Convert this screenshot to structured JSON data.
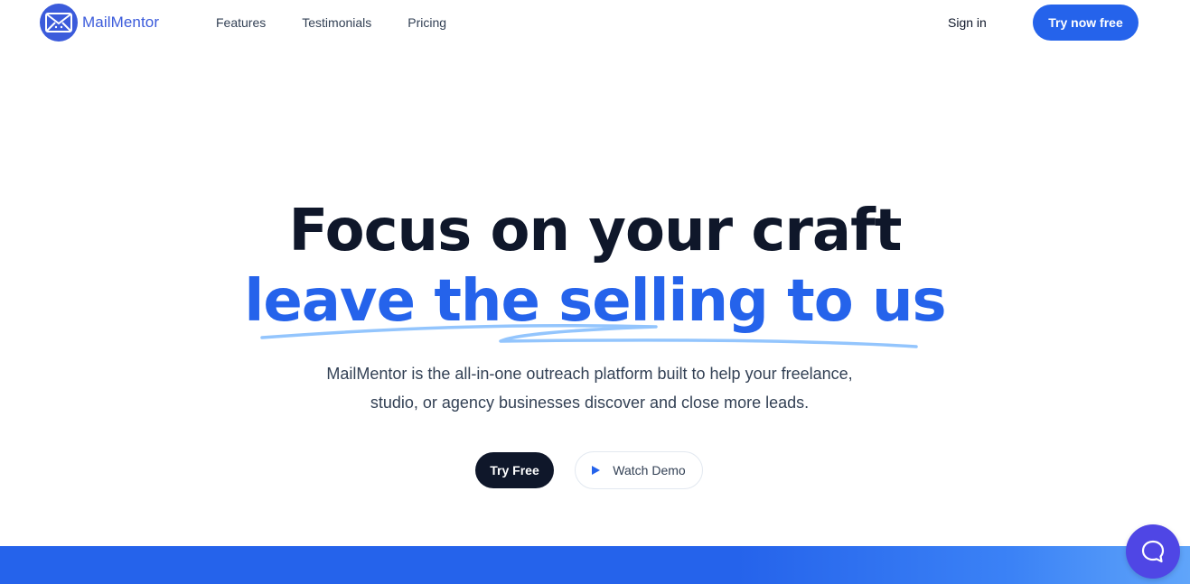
{
  "header": {
    "brand": "MailMentor",
    "nav": [
      "Features",
      "Testimonials",
      "Pricing"
    ],
    "sign_in": "Sign in",
    "cta": "Try now free"
  },
  "hero": {
    "title_line1": "Focus on your craft",
    "title_line2": "leave the selling to us",
    "description_line1": "MailMentor is the all-in-one outreach platform built to help your freelance,",
    "description_line2": "studio, or agency businesses discover and close more leads.",
    "primary_button": "Try Free",
    "secondary_button": "Watch Demo"
  },
  "icons": {
    "logo": "envelope-icon",
    "play": "play-icon",
    "chat": "chat-icon"
  },
  "colors": {
    "accent": "#2563eb",
    "brand": "#3b5bdb",
    "dark": "#0f172a",
    "chat": "#4f46e5"
  }
}
